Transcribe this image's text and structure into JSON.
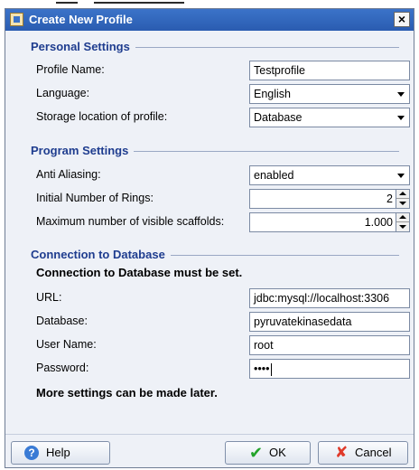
{
  "window": {
    "title": "Create New Profile",
    "close_glyph": "×"
  },
  "personal": {
    "heading": "Personal Settings",
    "profile_name_label": "Profile Name:",
    "profile_name_value": "Testprofile",
    "language_label": "Language:",
    "language_value": "English",
    "storage_label": "Storage location of profile:",
    "storage_value": "Database"
  },
  "program": {
    "heading": "Program Settings",
    "anti_aliasing_label": "Anti Aliasing:",
    "anti_aliasing_value": "enabled",
    "rings_label": "Initial Number of Rings:",
    "rings_value": "2",
    "scaffolds_label": "Maximum number of visible scaffolds:",
    "scaffolds_value": "1.000"
  },
  "database": {
    "heading": "Connection to Database",
    "notice": "Connection to Database must be set.",
    "url_label": "URL:",
    "url_value": "jdbc:mysql://localhost:3306",
    "db_label": "Database:",
    "db_value": "pyruvatekinasedata",
    "user_label": "User Name:",
    "user_value": "root",
    "password_label": "Password:",
    "password_mask": "••••",
    "later_note": "More settings can be made later."
  },
  "buttons": {
    "help": "Help",
    "ok": "OK",
    "cancel": "Cancel"
  },
  "icons": {
    "help": "help-icon",
    "ok": "checkmark-icon",
    "cancel": "x-icon",
    "app": "java-app-icon"
  },
  "colors": {
    "titlebar": "#2f66bd",
    "section_heading": "#1f3d8f",
    "window_bg": "#eef1f7"
  }
}
